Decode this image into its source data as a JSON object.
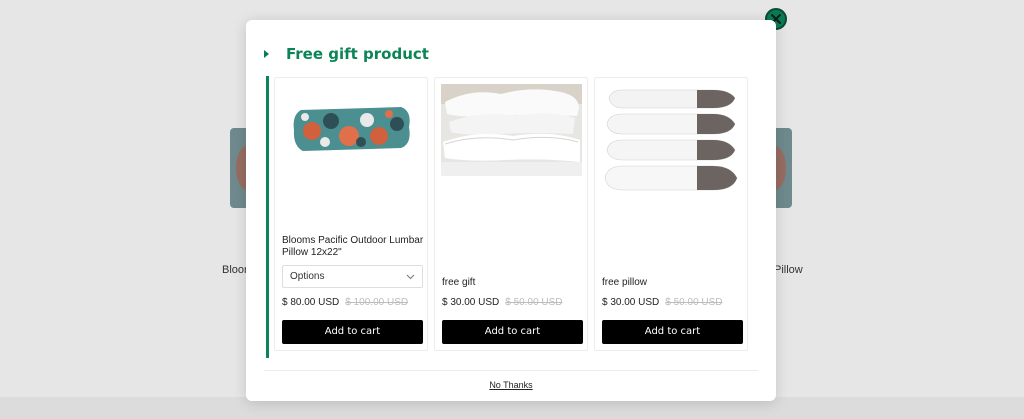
{
  "background": {
    "left_product_text": "Bloom",
    "right_product_text": "Pillow"
  },
  "modal": {
    "title": "Free gift product",
    "no_thanks_label": "No Thanks",
    "close_icon": "close-icon"
  },
  "products": [
    {
      "name": "Blooms Pacific Outdoor Lumbar Pillow 12x22\"",
      "has_options": true,
      "options_selected": "Options",
      "price": "$ 80.00 USD",
      "compare_price": "$ 100.00 USD",
      "button_label": "Add to cart"
    },
    {
      "name": "free gift",
      "has_options": false,
      "price": "$ 30.00 USD",
      "compare_price": "$ 50.00 USD",
      "button_label": "Add to cart"
    },
    {
      "name": "free pillow",
      "has_options": false,
      "price": "$ 30.00 USD",
      "compare_price": "$ 50.00 USD",
      "button_label": "Add to cart"
    }
  ],
  "colors": {
    "accent": "#0b8457",
    "button": "#000000",
    "compare_price": "#bdbdbd"
  }
}
